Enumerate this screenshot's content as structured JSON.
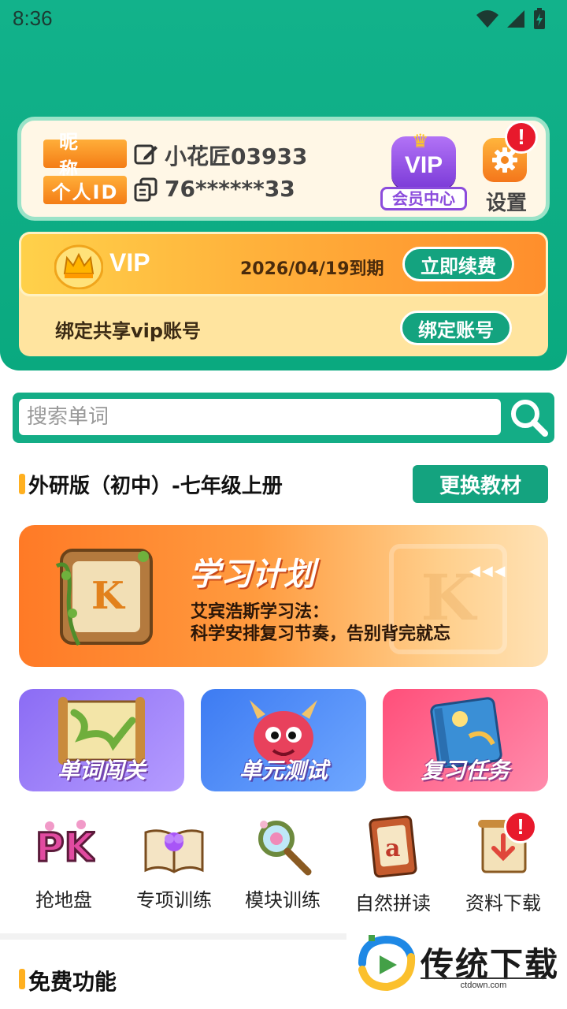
{
  "status_bar": {
    "time": "8:36"
  },
  "profile": {
    "nick_label": "昵称",
    "id_label": "个人ID",
    "nickname": "小花匠03933",
    "user_id": "76******33",
    "vip_badge_text": "VIP",
    "vip_center_label": "会员中心",
    "settings_label": "设置",
    "settings_badge": "!"
  },
  "vip_card": {
    "title": "VIP",
    "expire": "2026/04/19到期",
    "renew_label": "立即续费",
    "bind_text": "绑定共享vip账号",
    "bind_button": "绑定账号"
  },
  "search": {
    "placeholder": "搜索单词"
  },
  "textbook": {
    "title": "外研版（初中）-七年级上册",
    "change_label": "更换教材"
  },
  "plan_banner": {
    "title": "学习计划",
    "line1": "艾宾浩斯学习法：",
    "line2": "科学安排复习节奏，告别背完就忘",
    "watermark_letter": "K",
    "icon_letter": "K"
  },
  "tiles": [
    {
      "label": "单词闯关",
      "icon": "map-scroll-icon"
    },
    {
      "label": "单元测试",
      "icon": "monster-icon"
    },
    {
      "label": "复习任务",
      "icon": "book-icon"
    }
  ],
  "mini_features": [
    {
      "label": "抢地盘",
      "icon": "pk-icon"
    },
    {
      "label": "专项训练",
      "icon": "open-book-icon"
    },
    {
      "label": "模块训练",
      "icon": "magnifier-icon"
    },
    {
      "label": "自然拼读",
      "icon": "letter-card-icon",
      "letter": "a"
    },
    {
      "label": "资料下载",
      "icon": "download-scroll-icon",
      "badge": "!"
    }
  ],
  "free_section": {
    "title": "免费功能"
  },
  "watermark": {
    "name": "传统下载",
    "url": "ctdown.com"
  },
  "colors": {
    "primary": "#14a37f",
    "orange": "#f47d16",
    "badge_red": "#e8192c"
  }
}
